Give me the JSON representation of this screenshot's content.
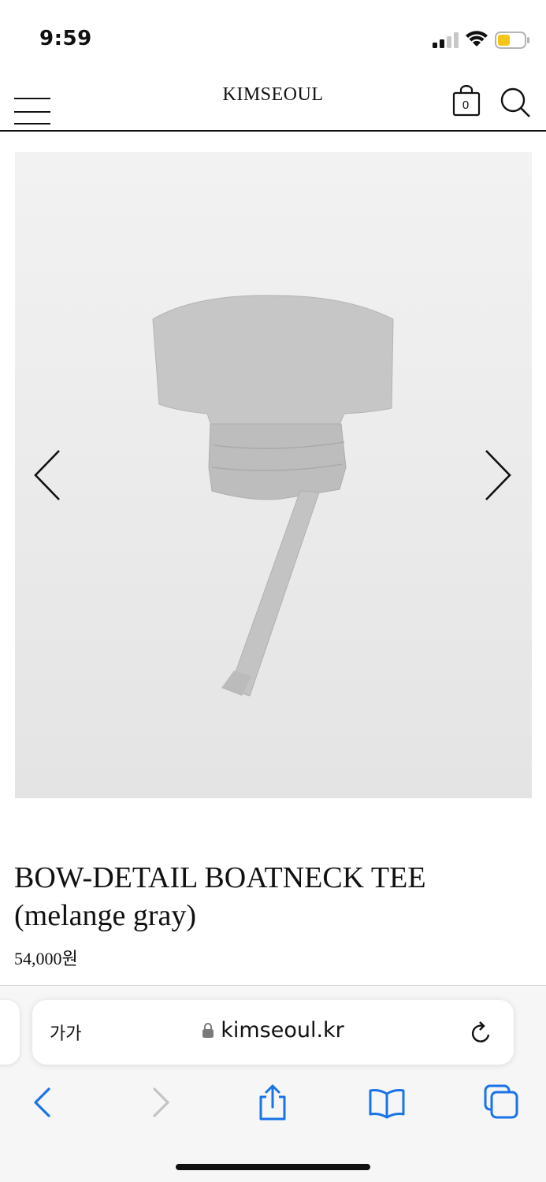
{
  "status_bar": {
    "time": "9:59",
    "battery_color": "#f5c518"
  },
  "header": {
    "logo": "KIMSEOUL",
    "cart_count": "0"
  },
  "icons": {
    "menu": "hamburger-icon",
    "cart": "bag-icon",
    "search": "search-icon",
    "prev": "chevron-left-icon",
    "next": "chevron-right-icon",
    "lock": "lock-icon",
    "reload": "reload-icon",
    "back": "back-icon",
    "forward": "forward-icon",
    "share": "share-icon",
    "bookmarks": "book-icon",
    "tabs": "tabs-icon"
  },
  "product": {
    "title": "BOW-DETAIL BOATNECK TEE (melange gray)",
    "price": "54,000원",
    "image_alt_color": "#c4c4c4"
  },
  "browser": {
    "text_size_label": "가가",
    "url": "kimseoul.kr",
    "accent_color": "#1a73e8"
  }
}
